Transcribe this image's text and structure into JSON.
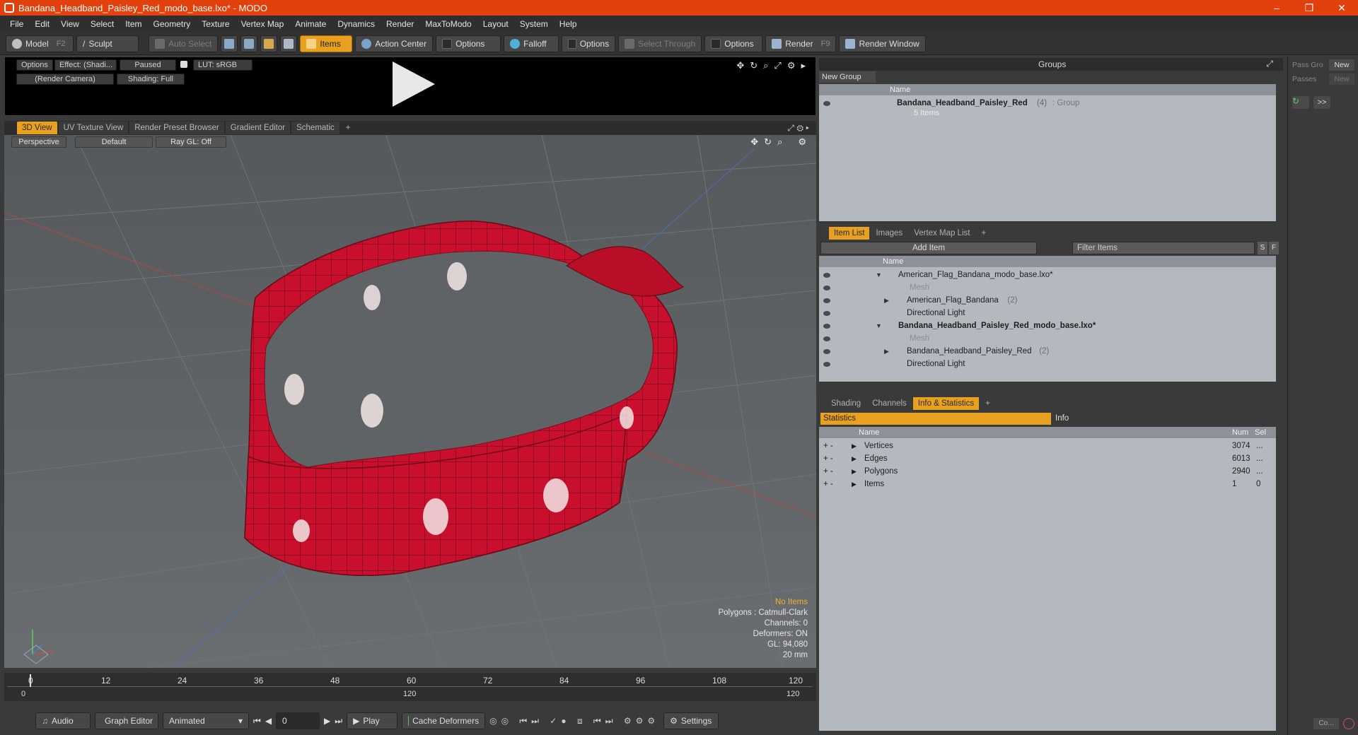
{
  "window": {
    "title": "Bandana_Headband_Paisley_Red_modo_base.lxo* - MODO",
    "minimize": "–",
    "maximize": "❐",
    "close": "✕"
  },
  "menu": [
    "File",
    "Edit",
    "View",
    "Select",
    "Item",
    "Geometry",
    "Texture",
    "Vertex Map",
    "Animate",
    "Dynamics",
    "Render",
    "MaxToModo",
    "Layout",
    "System",
    "Help"
  ],
  "toolbar": {
    "model": "Model",
    "model_key": "F2",
    "sculpt": "Sculpt",
    "auto_select": "Auto Select",
    "items": "Items",
    "action_center": "Action Center",
    "options1": "Options",
    "falloff": "Falloff",
    "options2": "Options",
    "select_through": "Select Through",
    "options3": "Options",
    "render": "Render",
    "render_key": "F9",
    "render_window": "Render Window"
  },
  "preview": {
    "options": "Options",
    "effect": "Effect: (Shadi...",
    "paused": "Paused",
    "lut": "LUT: sRGB",
    "camera": "(Render Camera)",
    "shading": "Shading: Full"
  },
  "viewport_tabs": [
    "3D View",
    "UV Texture View",
    "Render Preset Browser",
    "Gradient Editor",
    "Schematic",
    "+"
  ],
  "viewport": {
    "perspective": "Perspective",
    "default": "Default",
    "raygl": "Ray GL: Off",
    "info": {
      "no_items": "No Items",
      "polygons": "Polygons : Catmull-Clark",
      "channels": "Channels: 0",
      "deformers": "Deformers: ON",
      "gl": "GL: 94,080",
      "scale": "20 mm"
    }
  },
  "timeline": {
    "ticks": [
      "0",
      "12",
      "24",
      "36",
      "48",
      "60",
      "72",
      "84",
      "96",
      "108",
      "120"
    ],
    "range_start": "0",
    "range_mid": "120",
    "range_end": "120"
  },
  "bottom": {
    "audio": "Audio",
    "graph_editor": "Graph Editor",
    "animated": "Animated",
    "frame": "0",
    "play": "Play",
    "cache": "Cache Deformers",
    "settings": "Settings"
  },
  "groups": {
    "header": "Groups",
    "new_group": "New Group",
    "col_name": "Name",
    "item_name": "Bandana_Headband_Paisley_Red",
    "item_count": "(4)",
    "item_type": ": Group",
    "item_sub": "5 Items"
  },
  "item_list": {
    "tabs": [
      "Item List",
      "Images",
      "Vertex Map List",
      "+"
    ],
    "add_item": "Add Item",
    "filter": "Filter Items",
    "s": "S",
    "f": "F",
    "col_name": "Name",
    "rows": [
      {
        "label": "American_Flag_Bandana_modo_base.lxo*",
        "indent": 0,
        "bold": false,
        "dim": false,
        "count": ""
      },
      {
        "label": "Mesh",
        "indent": 2,
        "bold": false,
        "dim": true,
        "count": ""
      },
      {
        "label": "American_Flag_Bandana",
        "indent": 1,
        "bold": false,
        "dim": false,
        "count": "(2)"
      },
      {
        "label": "Directional Light",
        "indent": 1,
        "bold": false,
        "dim": false,
        "count": ""
      },
      {
        "label": "Bandana_Headband_Paisley_Red_modo_base.lxo*",
        "indent": 0,
        "bold": true,
        "dim": false,
        "count": ""
      },
      {
        "label": "Mesh",
        "indent": 2,
        "bold": false,
        "dim": true,
        "count": ""
      },
      {
        "label": "Bandana_Headband_Paisley_Red",
        "indent": 1,
        "bold": false,
        "dim": false,
        "count": "(2)"
      },
      {
        "label": "Directional Light",
        "indent": 1,
        "bold": false,
        "dim": false,
        "count": ""
      }
    ]
  },
  "stats": {
    "tabs": [
      "Shading",
      "Channels",
      "Info & Statistics",
      "+"
    ],
    "statistics": "Statistics",
    "info": "Info",
    "col_name": "Name",
    "col_num": "Num",
    "col_sel": "Sel",
    "rows": [
      {
        "name": "Vertices",
        "num": "3074",
        "sel": "..."
      },
      {
        "name": "Edges",
        "num": "6013",
        "sel": "..."
      },
      {
        "name": "Polygons",
        "num": "2940",
        "sel": "..."
      },
      {
        "name": "Items",
        "num": "1",
        "sel": "0"
      }
    ]
  },
  "pass": {
    "pass_gro": "Pass Gro",
    "passes": "Passes",
    "new": "New",
    "more": ">>",
    "co": "Co..."
  },
  "colors": {
    "title_bar": "#e2400c",
    "accent": "#e8a020",
    "bandana": "#c8102e"
  }
}
